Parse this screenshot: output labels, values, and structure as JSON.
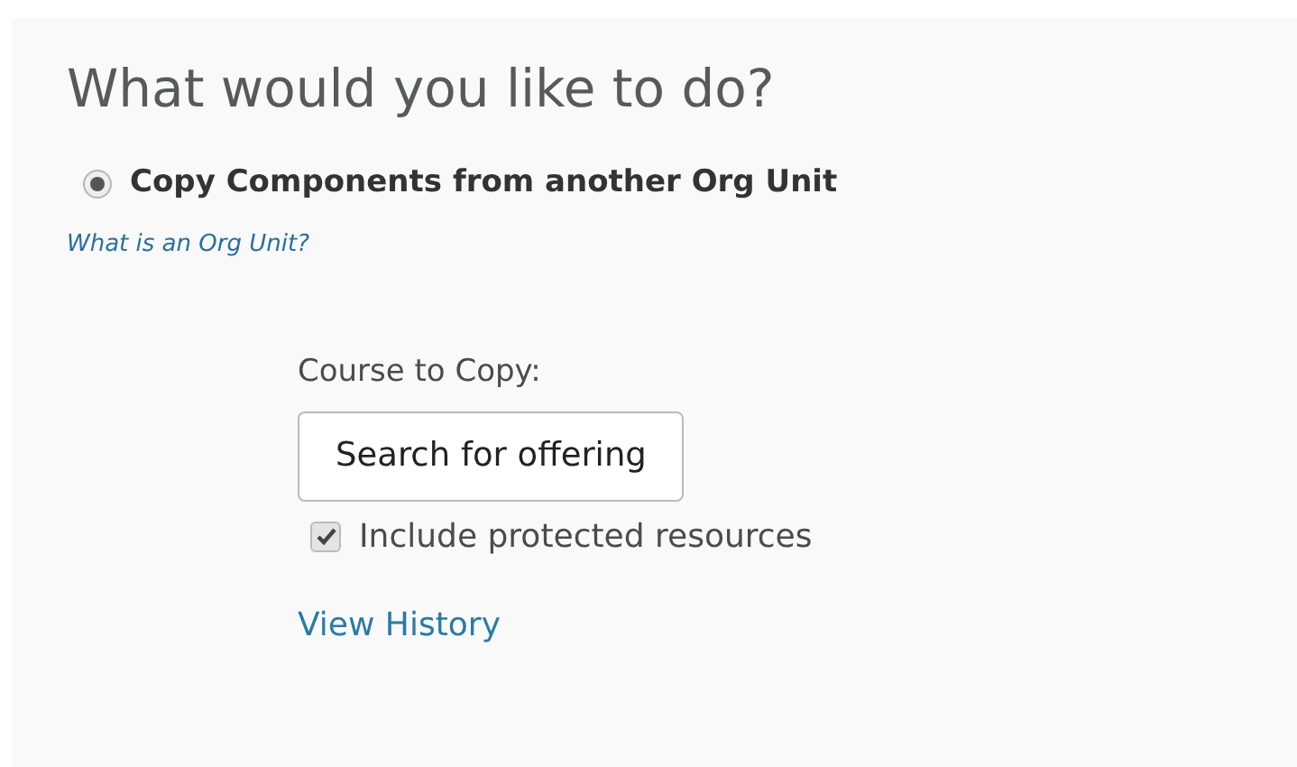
{
  "heading": "What would you like to do?",
  "option": {
    "label": "Copy Components from another Org Unit",
    "selected": true
  },
  "help_link": "What is an Org Unit?",
  "course_label": "Course to Copy:",
  "search_button": "Search for offering",
  "include_protected": {
    "label": "Include protected resources",
    "checked": true
  },
  "history_link": "View History"
}
